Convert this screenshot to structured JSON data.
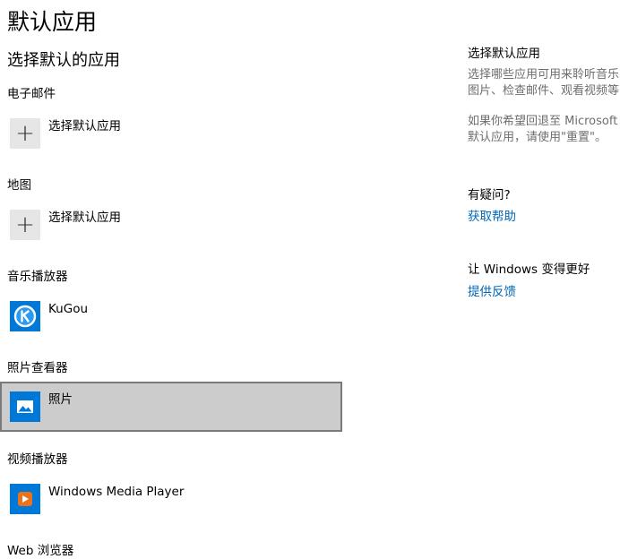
{
  "page": {
    "title": "默认应用"
  },
  "main": {
    "section_title": "选择默认的应用",
    "categories": [
      {
        "label": "电子邮件",
        "app_label": "选择默认应用",
        "icon": "plus-icon"
      },
      {
        "label": "地图",
        "app_label": "选择默认应用",
        "icon": "plus-icon"
      },
      {
        "label": "音乐播放器",
        "app_label": "KuGou",
        "icon": "kugou-icon"
      },
      {
        "label": "照片查看器",
        "app_label": "照片",
        "icon": "photos-icon",
        "selected": true
      },
      {
        "label": "视频播放器",
        "app_label": "Windows Media Player",
        "icon": "windows-media-player-icon"
      },
      {
        "label": "Web 浏览器"
      }
    ]
  },
  "sidebar": {
    "info_heading": "选择默认应用",
    "info_lines": [
      "选择哪些应用可用来聆听音乐",
      "图片、检查邮件、观看视频等",
      "如果你希望回退至 Microsoft 推",
      "默认应用，请使用\"重置\"。"
    ],
    "help_heading": "有疑问?",
    "help_link": "获取帮助",
    "feedback_heading": "让 Windows 变得更好",
    "feedback_link": "提供反馈"
  },
  "colors": {
    "accent_link": "#0067b8",
    "selected_background": "#cccccc",
    "selected_border": "#7a7a7a",
    "icon_blue": "#0078d7",
    "wmp_orange": "#e8731c"
  }
}
